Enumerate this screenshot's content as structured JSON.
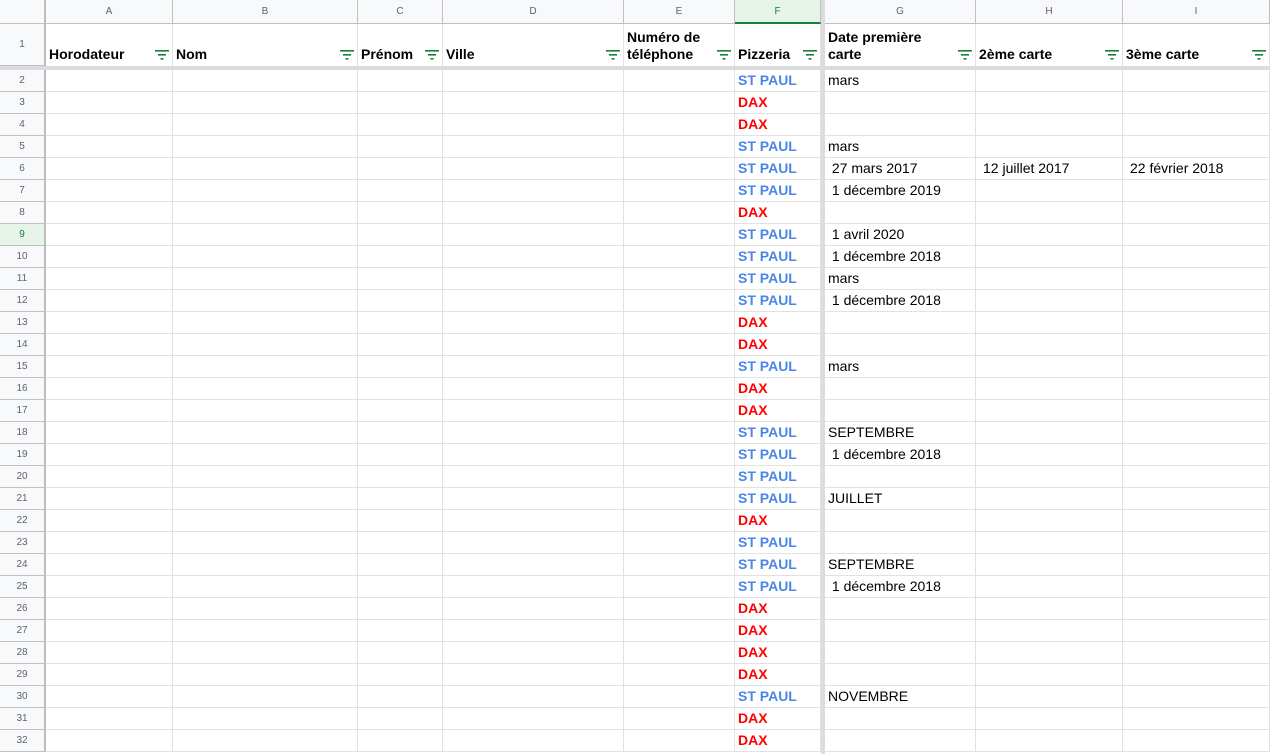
{
  "columns": [
    "A",
    "B",
    "C",
    "D",
    "E",
    "F",
    "G",
    "H",
    "I"
  ],
  "row_numbers": [
    "1",
    "2",
    "3",
    "4",
    "5",
    "6",
    "7",
    "8",
    "9",
    "10",
    "11",
    "12",
    "13",
    "14",
    "15",
    "16",
    "17",
    "18",
    "19",
    "20",
    "21",
    "22",
    "23",
    "24",
    "25",
    "26",
    "27",
    "28",
    "29",
    "30",
    "31",
    "32"
  ],
  "headers": [
    "Horodateur",
    "Nom",
    "Prénom",
    "Ville",
    "Numéro de\ntéléphone",
    "Pizzeria",
    "Date première\ncarte",
    "2ème carte",
    "3ème carte"
  ],
  "colors": {
    "st_paul": "#4a86e8",
    "dax": "#ff0000",
    "selection_green": "#188038"
  },
  "rows": [
    {
      "pizzeria": "ST PAUL",
      "first": "mars",
      "second": "",
      "third": ""
    },
    {
      "pizzeria": "DAX",
      "first": "",
      "second": "",
      "third": ""
    },
    {
      "pizzeria": "DAX",
      "first": "",
      "second": "",
      "third": ""
    },
    {
      "pizzeria": "ST PAUL",
      "first": "mars",
      "second": "",
      "third": ""
    },
    {
      "pizzeria": "ST PAUL",
      "first": " 27 mars 2017",
      "second": " 12 juillet 2017",
      "third": " 22 février 2018"
    },
    {
      "pizzeria": "ST PAUL",
      "first": " 1 décembre 2019",
      "second": "",
      "third": ""
    },
    {
      "pizzeria": "DAX",
      "first": "",
      "second": "",
      "third": ""
    },
    {
      "pizzeria": "ST PAUL",
      "first": " 1 avril 2020",
      "second": "",
      "third": ""
    },
    {
      "pizzeria": "ST PAUL",
      "first": " 1 décembre 2018",
      "second": "",
      "third": ""
    },
    {
      "pizzeria": "ST PAUL",
      "first": "mars",
      "second": "",
      "third": ""
    },
    {
      "pizzeria": "ST PAUL",
      "first": " 1 décembre 2018",
      "second": "",
      "third": ""
    },
    {
      "pizzeria": "DAX",
      "first": "",
      "second": "",
      "third": ""
    },
    {
      "pizzeria": "DAX",
      "first": "",
      "second": "",
      "third": ""
    },
    {
      "pizzeria": "ST PAUL",
      "first": "mars",
      "second": "",
      "third": ""
    },
    {
      "pizzeria": "DAX",
      "first": "",
      "second": "",
      "third": ""
    },
    {
      "pizzeria": "DAX",
      "first": "",
      "second": "",
      "third": ""
    },
    {
      "pizzeria": "ST PAUL",
      "first": "SEPTEMBRE",
      "second": "",
      "third": ""
    },
    {
      "pizzeria": "ST PAUL",
      "first": " 1 décembre 2018",
      "second": "",
      "third": ""
    },
    {
      "pizzeria": "ST PAUL",
      "first": "",
      "second": "",
      "third": ""
    },
    {
      "pizzeria": "ST PAUL",
      "first": "JUILLET",
      "second": "",
      "third": ""
    },
    {
      "pizzeria": "DAX",
      "first": "",
      "second": "",
      "third": ""
    },
    {
      "pizzeria": "ST PAUL",
      "first": "",
      "second": "",
      "third": ""
    },
    {
      "pizzeria": "ST PAUL",
      "first": "SEPTEMBRE",
      "second": "",
      "third": ""
    },
    {
      "pizzeria": "ST PAUL",
      "first": " 1 décembre 2018",
      "second": "",
      "third": ""
    },
    {
      "pizzeria": "DAX",
      "first": "",
      "second": "",
      "third": ""
    },
    {
      "pizzeria": "DAX",
      "first": "",
      "second": "",
      "third": ""
    },
    {
      "pizzeria": "DAX",
      "first": "",
      "second": "",
      "third": ""
    },
    {
      "pizzeria": "DAX",
      "first": "",
      "second": "",
      "third": ""
    },
    {
      "pizzeria": "ST PAUL",
      "first": "NOVEMBRE",
      "second": "",
      "third": ""
    },
    {
      "pizzeria": "DAX",
      "first": "",
      "second": "",
      "third": ""
    },
    {
      "pizzeria": "DAX",
      "first": "",
      "second": "",
      "third": ""
    }
  ],
  "selected_row": "9",
  "selected_column": "F"
}
